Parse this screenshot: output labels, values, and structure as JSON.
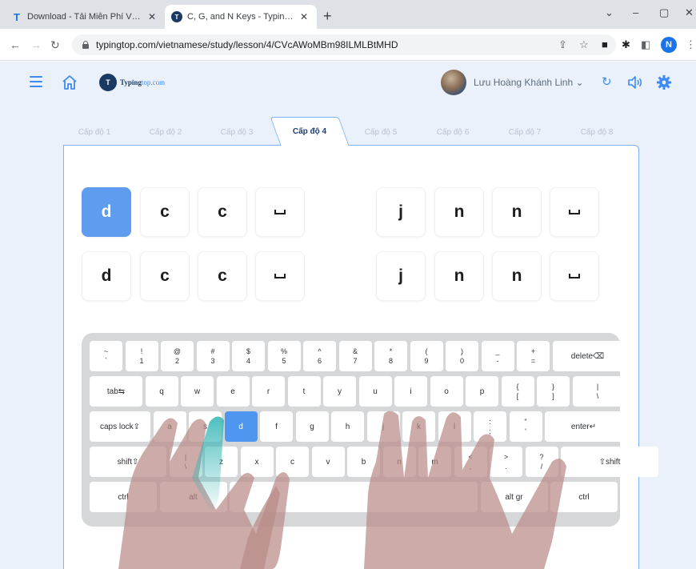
{
  "browser": {
    "tabs": [
      {
        "title": "Download - Tải Miễn Phí VN - Ph",
        "favicon": "typingtop-t-icon"
      },
      {
        "title": "C, G, and N Keys - TypingTop",
        "favicon": "typingtop-logo-icon"
      }
    ],
    "url": "typingtop.com/vietnamese/study/lesson/4/CVcAWoMBm98ILMLBtMHD",
    "profile_initial": "N",
    "window_controls": [
      "⌄",
      "–",
      "▢",
      "✕"
    ]
  },
  "site": {
    "logo_text": "Typing",
    "logo_suffix": "top.com",
    "user_name": "Lưu Hoàng Khánh Linh",
    "colors": {
      "accent": "#3d8bf2",
      "highlight_key": "#4f96f0",
      "background": "#eaf1fb",
      "hand": "#b98a88",
      "finger_highlight": "#2fb3b3"
    }
  },
  "levels": [
    {
      "label": "Cấp độ 1",
      "active": false
    },
    {
      "label": "Cấp độ 2",
      "active": false
    },
    {
      "label": "Cấp độ 3",
      "active": false
    },
    {
      "label": "Cấp độ 4",
      "active": true
    },
    {
      "label": "Cấp độ 5",
      "active": false
    },
    {
      "label": "Cấp độ 6",
      "active": false
    },
    {
      "label": "Cấp độ 7",
      "active": false
    },
    {
      "label": "Cấp độ 8",
      "active": false
    }
  ],
  "exercise": {
    "row1": [
      "d",
      "c",
      "c",
      "␣",
      "j",
      "n",
      "n",
      "␣"
    ],
    "row2": [
      "d",
      "c",
      "c",
      "␣",
      "j",
      "n",
      "n",
      "␣"
    ],
    "current_index": 0
  },
  "keyboard": {
    "row1": [
      [
        "~",
        "`"
      ],
      [
        "!",
        "1"
      ],
      [
        "@",
        "2"
      ],
      [
        "#",
        "3"
      ],
      [
        "$",
        "4"
      ],
      [
        "%",
        "5"
      ],
      [
        "^",
        "6"
      ],
      [
        "&",
        "7"
      ],
      [
        "*",
        "8"
      ],
      [
        "(",
        "9"
      ],
      [
        ")",
        "0"
      ],
      [
        "_",
        "-"
      ],
      [
        "+",
        "="
      ],
      [
        "delete⌫"
      ]
    ],
    "row2": [
      [
        "tab⇆"
      ],
      [
        "q"
      ],
      [
        "w"
      ],
      [
        "e"
      ],
      [
        "r"
      ],
      [
        "t"
      ],
      [
        "y"
      ],
      [
        "u"
      ],
      [
        "i"
      ],
      [
        "o"
      ],
      [
        "p"
      ],
      [
        "{",
        "["
      ],
      [
        "}",
        "]"
      ],
      [
        "|",
        "\\"
      ]
    ],
    "row3": [
      [
        "caps lock⇪"
      ],
      [
        "a"
      ],
      [
        "s"
      ],
      [
        "d"
      ],
      [
        "f"
      ],
      [
        "g"
      ],
      [
        "h"
      ],
      [
        "j"
      ],
      [
        "k"
      ],
      [
        "l"
      ],
      [
        ":",
        ";"
      ],
      [
        "\"",
        "'"
      ],
      [
        "enter↵"
      ]
    ],
    "row4": [
      [
        "shift⇧"
      ],
      [
        "|",
        "\\"
      ],
      [
        "z"
      ],
      [
        "x"
      ],
      [
        "c"
      ],
      [
        "v"
      ],
      [
        "b"
      ],
      [
        "n"
      ],
      [
        "m"
      ],
      [
        "<",
        ","
      ],
      [
        ">",
        "."
      ],
      [
        "?",
        "/"
      ],
      [
        "⇧shift"
      ]
    ],
    "row5": [
      [
        "ctrl"
      ],
      [
        "alt"
      ],
      [
        ""
      ],
      [
        "alt gr"
      ],
      [
        "ctrl"
      ]
    ],
    "highlighted_key": "d"
  }
}
